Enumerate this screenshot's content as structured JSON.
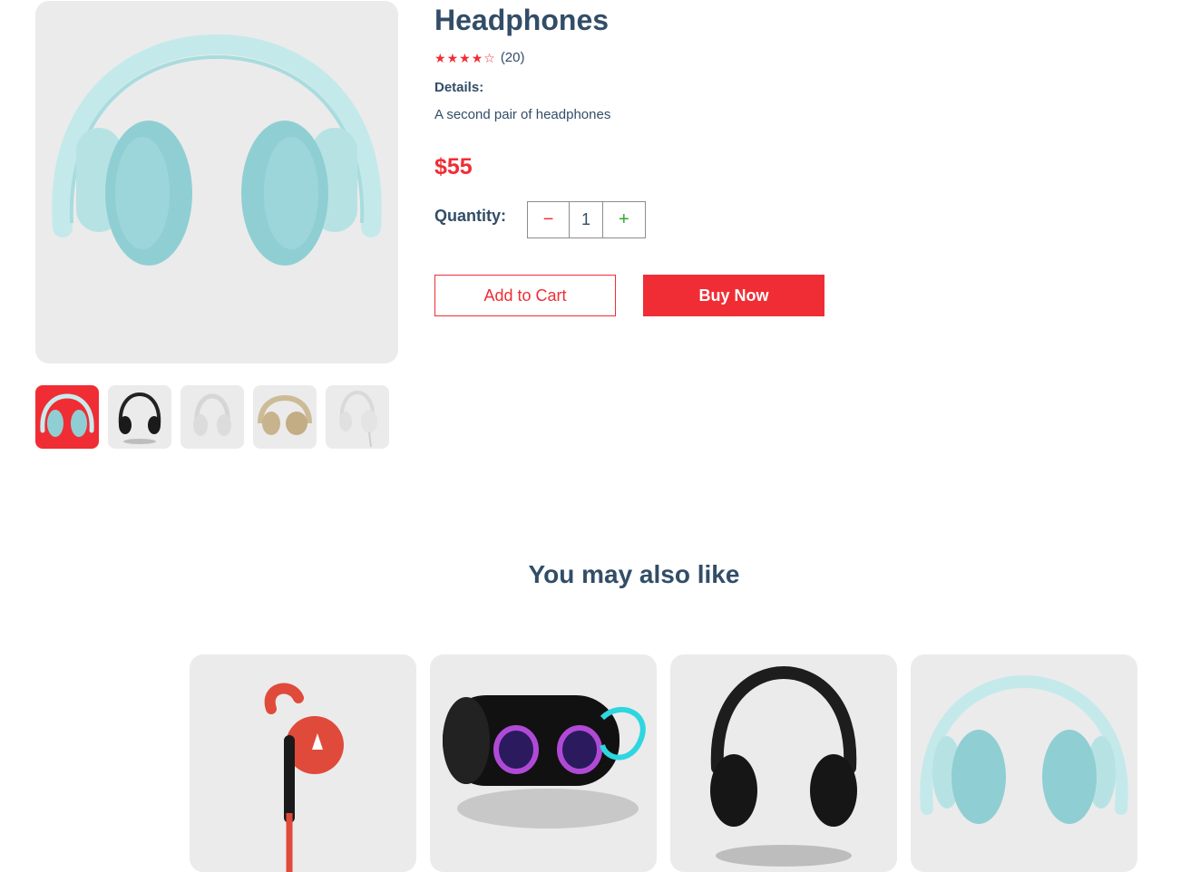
{
  "product": {
    "title": "Headphones",
    "rating": 4,
    "rating_max": 5,
    "reviews_count": "(20)",
    "details_heading": "Details:",
    "details_text": "A second pair of headphones",
    "price": "$55",
    "quantity_label": "Quantity:",
    "quantity_value": "1",
    "minus_symbol": "−",
    "plus_symbol": "+"
  },
  "gallery": {
    "main_image": "headphones-mint",
    "thumbnails": [
      {
        "image": "headphones-mint",
        "selected": true
      },
      {
        "image": "headphones-black"
      },
      {
        "image": "headphones-white"
      },
      {
        "image": "headphones-beige"
      },
      {
        "image": "headphones-white-wired"
      }
    ]
  },
  "actions": {
    "add_to_cart": "Add to Cart",
    "buy_now": "Buy Now"
  },
  "recommendations": {
    "heading": "You may also like",
    "items": [
      {
        "image": "red-earphones"
      },
      {
        "image": "speaker"
      },
      {
        "image": "headphones-black"
      },
      {
        "image": "headphones-mint"
      }
    ]
  },
  "colors": {
    "accent": "#f02d34",
    "text": "#324d67",
    "image_bg": "#ebebeb",
    "plus": "#31a831"
  }
}
